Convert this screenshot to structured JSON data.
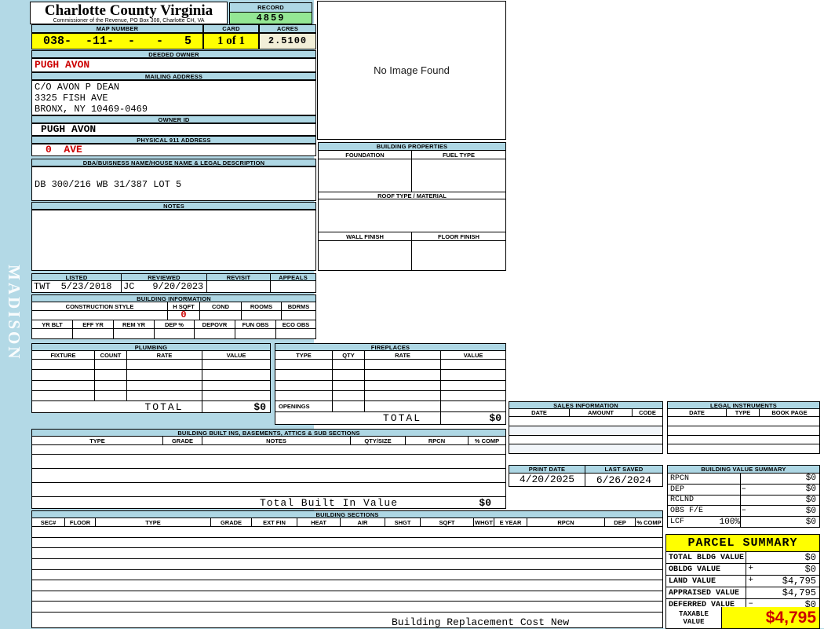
{
  "colors": {
    "page_blue": "#b3d9e6",
    "header_blue": "#aed7e4",
    "record_green": "#94e794",
    "highlight_yellow": "#ffff00",
    "acres_cream": "#f2efd8",
    "alert_red": "#cc0000"
  },
  "watermark": "MADISON",
  "header": {
    "county": "Charlotte County Virginia",
    "commissioner_line": "Commissioner of the Revenue, PO Box 308, Charlotte CH, VA",
    "record_label": "RECORD",
    "record_value": "4859",
    "map_number_label": "MAP NUMBER",
    "map_number_value": "038-  -11-  -   -   5",
    "card_label": "CARD",
    "card_value": "1 of 1",
    "acres_label": "ACRES",
    "acres_value": "2.5100"
  },
  "owner": {
    "deeded_owner_label": "DEEDED OWNER",
    "deeded_owner": "PUGH AVON",
    "mailing_address_label": "MAILING ADDRESS",
    "mailing_line1": "C/O AVON P DEAN",
    "mailing_line2": "3325 FISH AVE",
    "mailing_line3": "BRONX, NY 10469-0469",
    "owner_id_label": "OWNER ID",
    "owner_id": "PUGH AVON",
    "physical_address_label": "PHYSICAL 911 ADDRESS",
    "physical_address": "0  AVE",
    "dba_label": "DBA/BUISNESS NAME/HOUSE NAME & LEGAL DESCRIPTION",
    "legal_description": "DB 300/216 WB 31/387 LOT 5",
    "notes_label": "NOTES",
    "notes": ""
  },
  "image_panel": {
    "no_image_text": "No Image Found"
  },
  "building_properties": {
    "section_label": "BUILDING PROPERTIES",
    "foundation_label": "FOUNDATION",
    "fuel_type_label": "FUEL TYPE",
    "roof_label": "ROOF TYPE / MATERIAL",
    "wall_finish_label": "WALL FINISH",
    "floor_finish_label": "FLOOR FINISH"
  },
  "visits": {
    "listed_label": "LISTED",
    "listed_by": "TWT",
    "listed_date": "5/23/2018",
    "reviewed_label": "REVIEWED",
    "reviewed_by": "JC",
    "reviewed_date": "9/20/2023",
    "revisit_label": "REVISIT",
    "revisit_value": "",
    "appeals_label": "APPEALS",
    "appeals_value": ""
  },
  "building_information": {
    "section_label": "BUILDING INFORMATION",
    "style_label": "CONSTRUCTION STYLE",
    "hsqft_label": "H SQFT",
    "hsqft_value": "0",
    "cond_label": "COND",
    "rooms_label": "ROOMS",
    "bdrms_label": "BDRMS",
    "row2_labels": [
      "YR BLT",
      "EFF YR",
      "REM YR",
      "DEP %",
      "DEPOVR",
      "FUN OBS",
      "ECO OBS"
    ]
  },
  "plumbing": {
    "section_label": "PLUMBING",
    "headers": [
      "FIXTURE",
      "COUNT",
      "RATE",
      "VALUE"
    ],
    "total_label": "TOTAL",
    "total_value": "$0"
  },
  "fireplaces": {
    "section_label": "FIREPLACES",
    "headers": [
      "TYPE",
      "QTY",
      "RATE",
      "VALUE"
    ],
    "openings_label": "OPENINGS",
    "total_label": "TOTAL",
    "total_value": "$0"
  },
  "built_ins": {
    "section_label": "BUILDING BUILT INS, BASEMENTS, ATTICS & SUB SECTIONS",
    "headers": [
      "TYPE",
      "GRADE",
      "NOTES",
      "QTY/SIZE",
      "RPCN",
      "% COMP"
    ],
    "total_label": "Total Built In Value",
    "total_value": "$0"
  },
  "building_sections": {
    "section_label": "BUILDING SECTIONS",
    "headers": [
      "SEC#",
      "FLOOR",
      "TYPE",
      "GRADE",
      "EXT FIN",
      "HEAT",
      "AIR",
      "SHGT",
      "SQFT",
      "WHGT",
      "E YEAR",
      "RPCN",
      "DEP",
      "% COMP"
    ],
    "footer_label": "Building Replacement Cost New"
  },
  "sales": {
    "section_label": "SALES INFORMATION",
    "headers": [
      "DATE",
      "AMOUNT",
      "CODE"
    ]
  },
  "legal": {
    "section_label": "LEGAL INSTRUMENTS",
    "headers": [
      "DATE",
      "TYPE",
      "BOOK PAGE"
    ]
  },
  "dates": {
    "print_date_label": "PRINT DATE",
    "print_date": "4/20/2025",
    "last_saved_label": "LAST SAVED",
    "last_saved": "6/26/2024"
  },
  "building_value_summary": {
    "section_label": "BUILDING VALUE SUMMARY",
    "rows": [
      {
        "label": "RPCN",
        "pct": "",
        "op": "",
        "value": "$0"
      },
      {
        "label": "DEP",
        "pct": "",
        "op": "–",
        "value": "$0"
      },
      {
        "label": "RCLND",
        "pct": "",
        "op": "",
        "value": "$0"
      },
      {
        "label": "OBS F/E",
        "pct": "",
        "op": "–",
        "value": "$0"
      },
      {
        "label": "LCF",
        "pct": "100%",
        "op": "",
        "value": "$0"
      }
    ]
  },
  "parcel_summary": {
    "section_label": "PARCEL SUMMARY",
    "rows": [
      {
        "label": "TOTAL BLDG VALUE",
        "op": "",
        "value": "$0"
      },
      {
        "label": "OBLDG VALUE",
        "op": "+",
        "value": "$0"
      },
      {
        "label": "LAND VALUE",
        "op": "+",
        "value": "$4,795"
      },
      {
        "label": "APPRAISED VALUE",
        "op": "",
        "value": "$4,795"
      },
      {
        "label": "DEFERRED VALUE",
        "op": "–",
        "value": "$0"
      }
    ],
    "taxable_label_1": "TAXABLE",
    "taxable_label_2": "VALUE",
    "taxable_value": "$4,795"
  }
}
